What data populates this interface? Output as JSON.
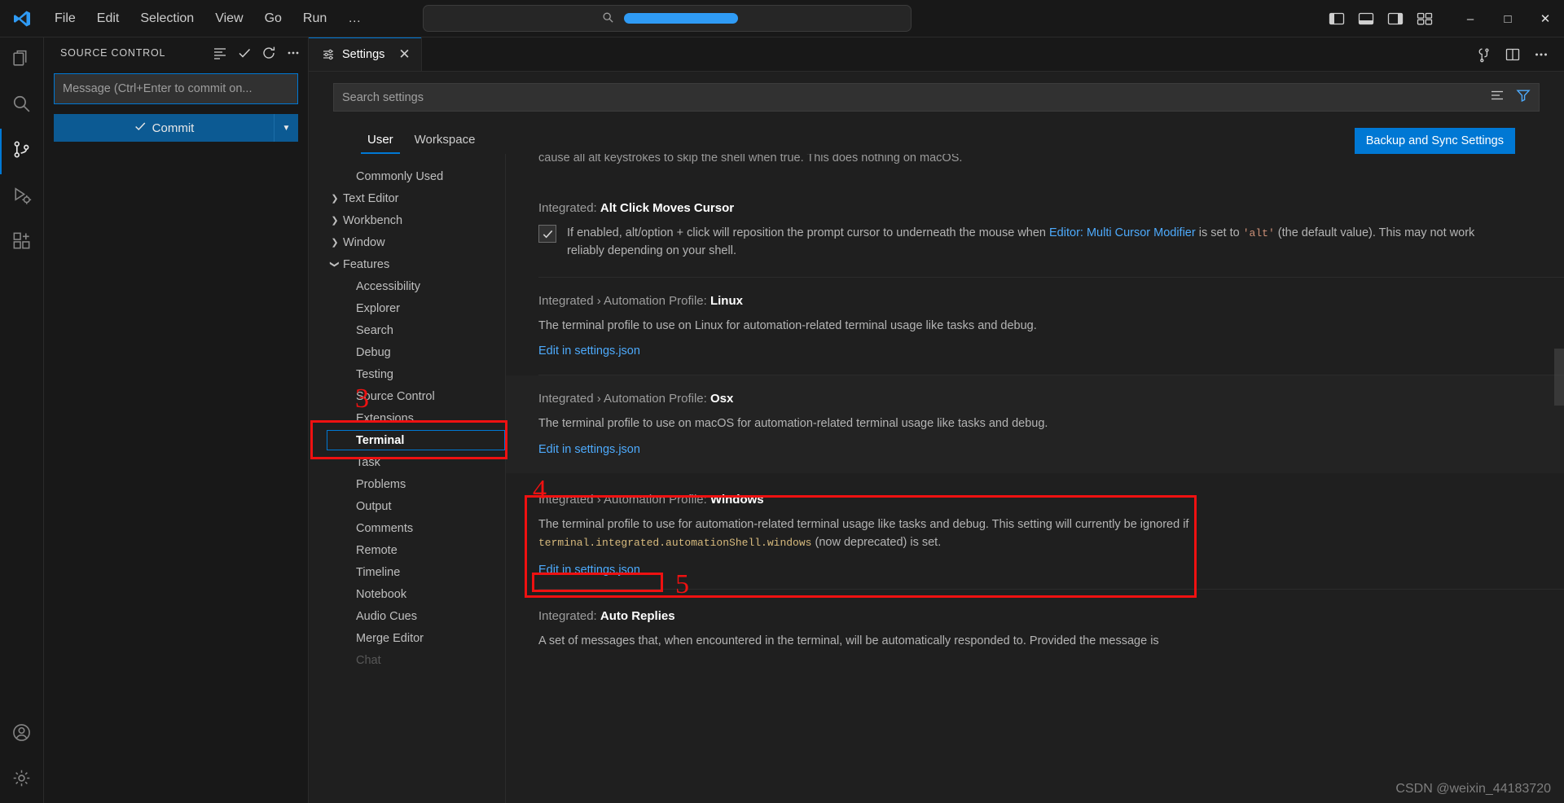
{
  "titlebar": {
    "logo_icon": "vscode-logo-icon",
    "menus": [
      "File",
      "Edit",
      "Selection",
      "View",
      "Go",
      "Run",
      "…"
    ],
    "nav_back_icon": "arrow-left-icon",
    "nav_forward_icon": "arrow-right-icon",
    "command_center_placeholder": "",
    "command_center_search_icon": "search-icon",
    "layout_icons": [
      "toggle-primary-sidebar-icon",
      "toggle-panel-icon",
      "toggle-secondary-sidebar-icon",
      "customize-layout-icon"
    ],
    "window_minimize": "–",
    "window_maximize": "□",
    "window_close": "✕"
  },
  "activitybar": {
    "items": [
      {
        "name": "explorer",
        "icon": "files-icon",
        "active": false
      },
      {
        "name": "search",
        "icon": "search-icon",
        "active": false
      },
      {
        "name": "source-control",
        "icon": "source-control-icon",
        "active": true
      },
      {
        "name": "run-and-debug",
        "icon": "run-debug-icon",
        "active": false
      },
      {
        "name": "extensions",
        "icon": "extensions-icon",
        "active": false
      }
    ],
    "bottom": [
      {
        "name": "accounts",
        "icon": "account-icon"
      },
      {
        "name": "manage",
        "icon": "gear-icon"
      }
    ]
  },
  "sidebar": {
    "title": "SOURCE CONTROL",
    "actions": [
      {
        "name": "view-and-sort",
        "icon": "list-icon"
      },
      {
        "name": "commit",
        "icon": "check-icon"
      },
      {
        "name": "refresh",
        "icon": "refresh-icon"
      },
      {
        "name": "views-and-more-actions",
        "icon": "ellipsis-icon"
      }
    ],
    "commit_message_placeholder": "Message (Ctrl+Enter to commit on...",
    "commit_message_value": "",
    "commit_button_label": "Commit",
    "commit_button_icon": "check-icon",
    "commit_dropdown_icon": "chevron-down-icon"
  },
  "tabs": {
    "items": [
      {
        "label": "Settings",
        "icon": "settings-tab-icon",
        "active": true,
        "close_icon": "close-icon"
      }
    ],
    "right_actions": [
      {
        "name": "split-editor-settings",
        "icon": "open-settings-json-icon"
      },
      {
        "name": "split-editor",
        "icon": "split-editor-icon"
      },
      {
        "name": "more-actions",
        "icon": "ellipsis-icon"
      }
    ]
  },
  "settings_header": {
    "search_placeholder": "Search settings",
    "search_value": "",
    "clear_filter_icon": "clear-filters-icon",
    "filter_icon": "filter-icon",
    "scope_tabs": [
      {
        "label": "User",
        "active": true
      },
      {
        "label": "Workspace",
        "active": false
      }
    ],
    "backup_button_label": "Backup and Sync Settings"
  },
  "toc": {
    "items": [
      {
        "label": "Commonly Used",
        "level": 0,
        "chevron": "",
        "selected": false
      },
      {
        "label": "Text Editor",
        "level": 0,
        "chevron": "collapsed",
        "selected": false
      },
      {
        "label": "Workbench",
        "level": 0,
        "chevron": "collapsed",
        "selected": false
      },
      {
        "label": "Window",
        "level": 0,
        "chevron": "collapsed",
        "selected": false
      },
      {
        "label": "Features",
        "level": 0,
        "chevron": "expanded",
        "selected": false
      },
      {
        "label": "Accessibility",
        "level": 1,
        "chevron": "",
        "selected": false
      },
      {
        "label": "Explorer",
        "level": 1,
        "chevron": "",
        "selected": false
      },
      {
        "label": "Search",
        "level": 1,
        "chevron": "",
        "selected": false
      },
      {
        "label": "Debug",
        "level": 1,
        "chevron": "",
        "selected": false
      },
      {
        "label": "Testing",
        "level": 1,
        "chevron": "",
        "selected": false
      },
      {
        "label": "Source Control",
        "level": 1,
        "chevron": "",
        "selected": false
      },
      {
        "label": "Extensions",
        "level": 1,
        "chevron": "",
        "selected": false
      },
      {
        "label": "Terminal",
        "level": 1,
        "chevron": "",
        "selected": true
      },
      {
        "label": "Task",
        "level": 1,
        "chevron": "",
        "selected": false
      },
      {
        "label": "Problems",
        "level": 1,
        "chevron": "",
        "selected": false
      },
      {
        "label": "Output",
        "level": 1,
        "chevron": "",
        "selected": false
      },
      {
        "label": "Comments",
        "level": 1,
        "chevron": "",
        "selected": false
      },
      {
        "label": "Remote",
        "level": 1,
        "chevron": "",
        "selected": false
      },
      {
        "label": "Timeline",
        "level": 1,
        "chevron": "",
        "selected": false
      },
      {
        "label": "Notebook",
        "level": 1,
        "chevron": "",
        "selected": false
      },
      {
        "label": "Audio Cues",
        "level": 1,
        "chevron": "",
        "selected": false
      },
      {
        "label": "Merge Editor",
        "level": 1,
        "chevron": "",
        "selected": false
      },
      {
        "label": "Chat",
        "level": 1,
        "chevron": "",
        "selected": false
      }
    ]
  },
  "settings": {
    "cut_off_top": "cause all alt keystrokes to skip the shell when true. This does nothing on macOS.",
    "alt_click": {
      "title_prefix": "Integrated: ",
      "title_bold": "Alt Click Moves Cursor",
      "checkbox_checked": true,
      "desc_part1": "If enabled, alt/option + click will reposition the prompt cursor to underneath the mouse when ",
      "desc_link1": "Editor: Multi Cursor Modifier",
      "desc_part2": " is set to ",
      "desc_code": "'alt'",
      "desc_part3": " (the default value). This may not work reliably depending on your shell."
    },
    "automation_linux": {
      "title_prefix": "Integrated › Automation Profile: ",
      "title_bold": "Linux",
      "desc": "The terminal profile to use on Linux for automation-related terminal usage like tasks and debug.",
      "edit_link": "Edit in settings.json"
    },
    "automation_osx": {
      "title_prefix": "Integrated › Automation Profile: ",
      "title_bold": "Osx",
      "desc": "The terminal profile to use on macOS for automation-related terminal usage like tasks and debug.",
      "edit_link": "Edit in settings.json"
    },
    "automation_windows": {
      "title_prefix": "Integrated › Automation Profile: ",
      "title_bold": "Windows",
      "desc_part1": "The terminal profile to use for automation-related terminal usage like tasks and debug. This setting will currently be ignored if ",
      "desc_code": "terminal.integrated.automationShell.windows",
      "desc_part2": " (now deprecated) is set.",
      "edit_link": "Edit in settings.json"
    },
    "auto_replies": {
      "title_prefix": "Integrated: ",
      "title_bold": "Auto Replies",
      "desc": "A set of messages that, when encountered in the terminal, will be automatically responded to. Provided the message is"
    }
  },
  "annotations": {
    "n3": "3",
    "n4": "4",
    "n5": "5"
  },
  "watermark": "CSDN @weixin_44183720",
  "colors": {
    "accent": "#0078d4",
    "annotation_red": "#ef1111",
    "link_blue": "#4daafc",
    "code_amber": "#d7ba7d"
  }
}
